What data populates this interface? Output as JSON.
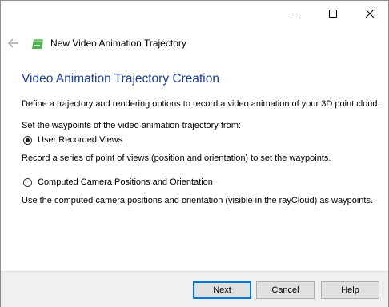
{
  "window": {
    "title_controls": {
      "minimize_icon": "minimize-icon",
      "maximize_icon": "maximize-icon",
      "close_icon": "close-icon"
    }
  },
  "header": {
    "back_icon": "back-arrow-icon",
    "app_icon": "wizard-icon",
    "title": "New Video Animation Trajectory"
  },
  "page": {
    "heading": "Video Animation Trajectory Creation",
    "intro": "Define a trajectory and rendering options to record a video animation of your 3D point cloud.",
    "waypoints_prompt": "Set the waypoints of the video animation trajectory from:",
    "options": [
      {
        "label": "User Recorded Views",
        "selected": true,
        "description": "Record a series of point of views (position and orientation) to set the waypoints."
      },
      {
        "label": "Computed Camera Positions and Orientation",
        "selected": false,
        "description": "Use the computed camera positions and orientation (visible in the rayCloud) as waypoints."
      }
    ]
  },
  "footer": {
    "next_label": "Next",
    "cancel_label": "Cancel",
    "help_label": "Help"
  },
  "colors": {
    "heading": "#1e3f9a",
    "default_button_border": "#0078d7",
    "footer_background": "#f0f0f0",
    "app_icon_green": "#4caf50"
  }
}
